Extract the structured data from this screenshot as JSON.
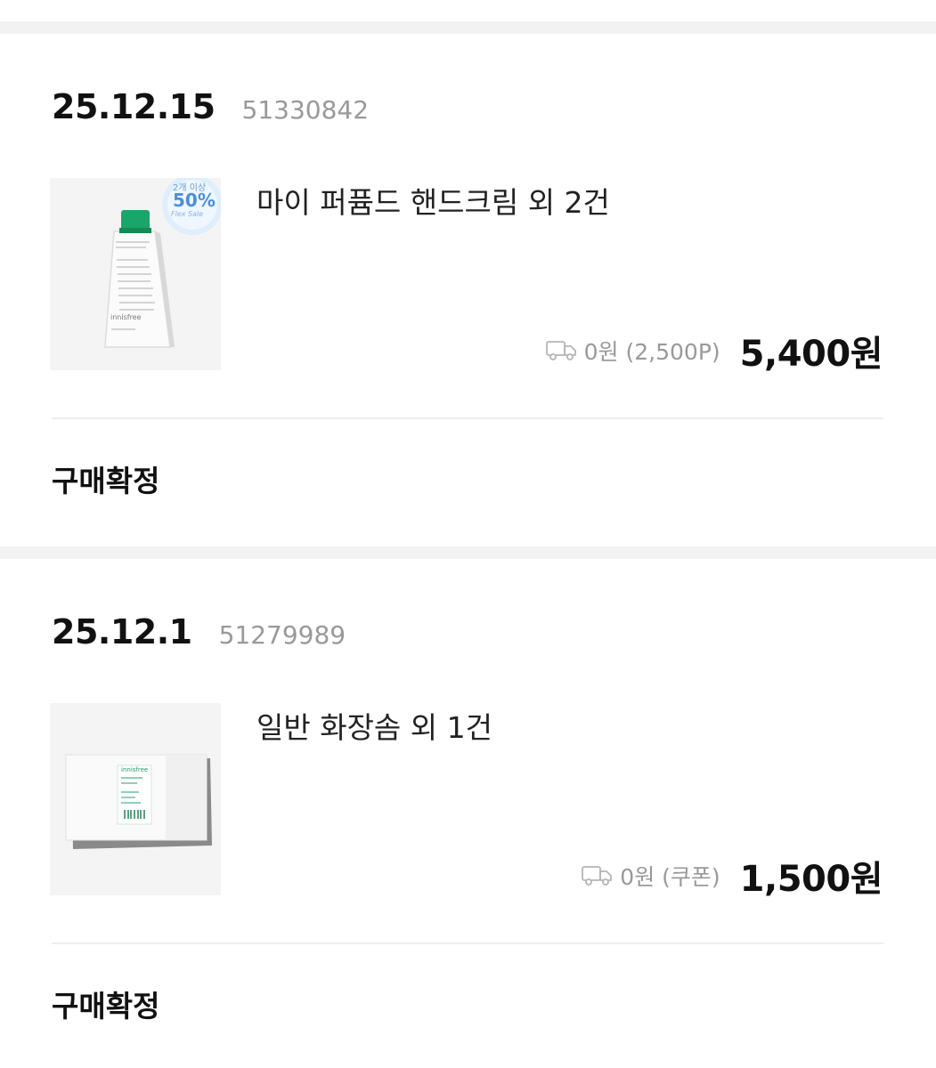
{
  "orders": [
    {
      "date": "25.12.15",
      "order_number": "51330842",
      "product_name": "마이 퍼퓸드 핸드크림 외 2건",
      "shipping_fee": "0원 (2,500P)",
      "price": "5,400원",
      "status": "구매확정",
      "thumb_badge": {
        "line1": "2개 이상",
        "line2": "50%",
        "line3": "Flex Sale"
      },
      "thumb_brand": "innisfree"
    },
    {
      "date": "25.12.1",
      "order_number": "51279989",
      "product_name": "일반 화장솜 외 1건",
      "shipping_fee": "0원 (쿠폰)",
      "price": "1,500원",
      "status": "구매확정",
      "thumb_brand": "innisfree"
    }
  ]
}
